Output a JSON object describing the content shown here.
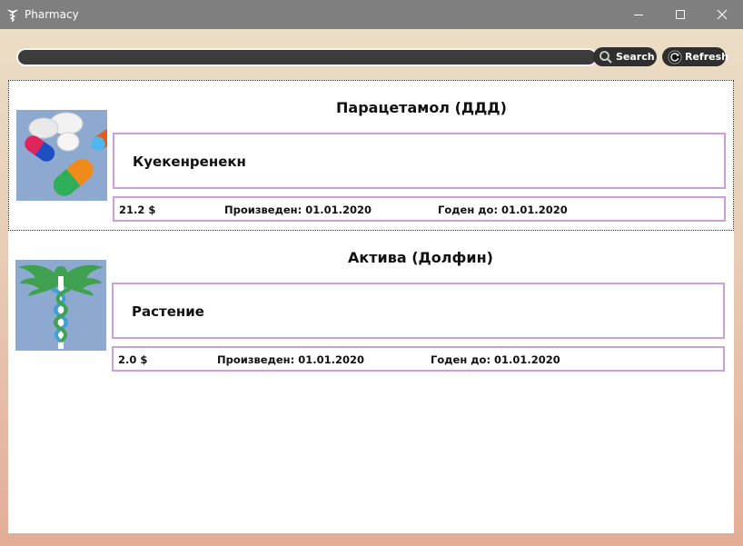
{
  "window": {
    "title": "Pharmacy",
    "icon": "caduceus-icon",
    "controls": [
      "minimize-icon",
      "maximize-icon",
      "close-icon"
    ]
  },
  "search": {
    "value": "",
    "placeholder": "",
    "search_label": "Search",
    "search_icon": "magnifier-icon",
    "refresh_label": "Refresh",
    "refresh_icon": "refresh-icon"
  },
  "products": [
    {
      "title": "Парацетамол (ДДД)",
      "description": "Куекенренекн",
      "price": "21.2 $",
      "produced": "Произведен: 01.01.2020",
      "expires": "Годен до: 01.01.2020",
      "image": "pills-image"
    },
    {
      "title": "Актива (Долфин)",
      "description": "Растение",
      "price": "2.0 $",
      "produced": "Произведен: 01.01.2020",
      "expires": "Годен до: 01.01.2020",
      "image": "caduceus-image"
    }
  ],
  "colors": {
    "titlebar": "#7f7f7f",
    "card_border": "#c9a0dc",
    "button_bg": "#2f2f2f",
    "image_bg": "#8ea9cf"
  }
}
